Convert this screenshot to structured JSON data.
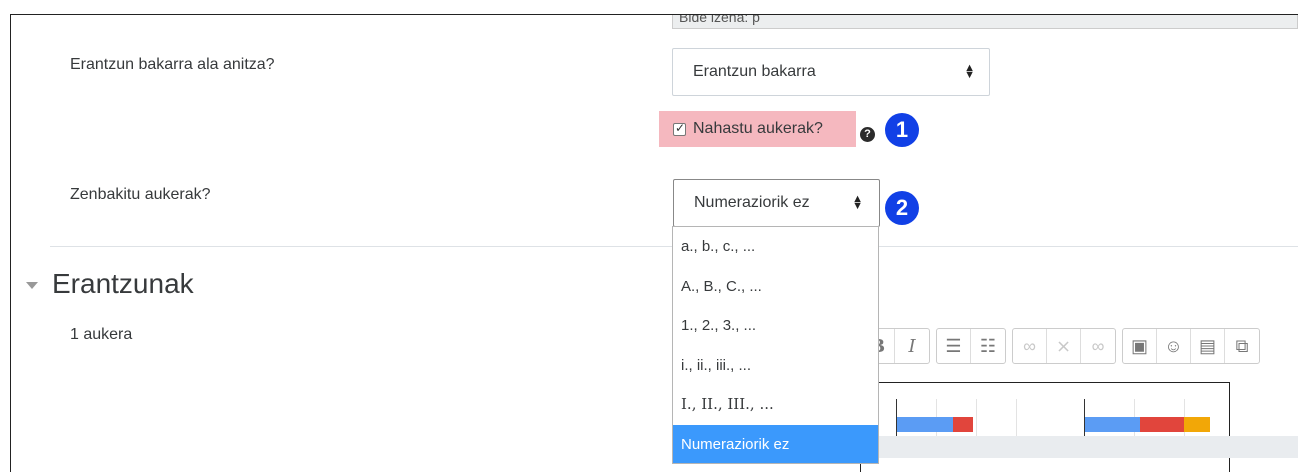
{
  "previous_field": {
    "value": "Bide izena: p"
  },
  "single_multiple": {
    "label": "Erantzun bakarra ala anitza?",
    "value": "Erantzun bakarra"
  },
  "shuffle": {
    "label": "Nahastu aukerak?",
    "checked": true
  },
  "badges": {
    "first": "1",
    "second": "2"
  },
  "numbering": {
    "label": "Zenbakitu aukerak?",
    "value": "Numeraziorik ez",
    "options": [
      "a., b., c., ...",
      "A., B., C., ...",
      "1., 2., 3., ...",
      "i., ii., iii., ...",
      "I., II., III., ...",
      "Numeraziorik ez"
    ],
    "selected_index": 5
  },
  "answers_section": {
    "title": "Erantzunak",
    "choice_label": "1 aukera"
  },
  "toolbar": {
    "groups": [
      [
        "bold-icon",
        "italic-icon"
      ],
      [
        "unordered-list-icon",
        "ordered-list-icon"
      ],
      [
        "link-icon",
        "unlink-icon",
        "anchor-icon"
      ],
      [
        "image-icon",
        "emoji-icon",
        "media-icon",
        "copy-icon"
      ]
    ]
  },
  "colors": {
    "accent": "#3b99fc",
    "badge": "#1140e6",
    "highlight": "#f5b8bf",
    "bar_blue": "#5b9cf4",
    "bar_red": "#e1453c",
    "bar_orange": "#f2a707"
  }
}
